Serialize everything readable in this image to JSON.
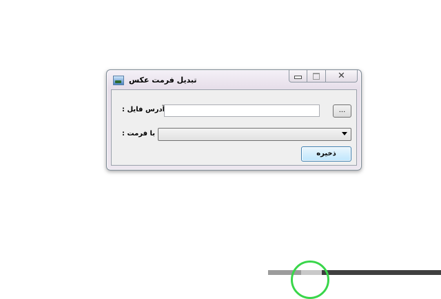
{
  "window": {
    "title": "تبدیل فرمت عکس",
    "title_icon": "picture-icon",
    "caption_buttons": {
      "minimize": "minimize-icon",
      "maximize": "maximize-icon",
      "close": "✕"
    }
  },
  "form": {
    "file_address_label": ": آدرس فایل",
    "file_address_value": "",
    "browse_label": "...",
    "format_label": ": با فرمت",
    "format_value": "",
    "save_label": "ذخیره"
  },
  "colors": {
    "highlight_ring": "#39d64a",
    "save_button_border": "#3c7fb1"
  }
}
